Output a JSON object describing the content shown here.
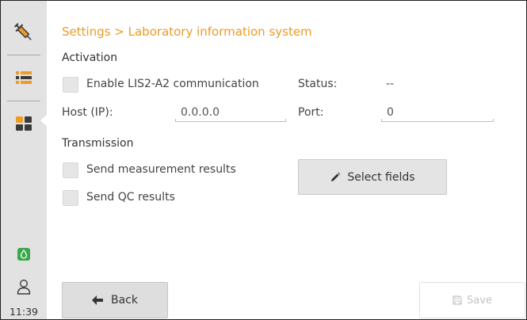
{
  "sidebar": {
    "items": [
      {
        "name": "syringe-icon",
        "active": false
      },
      {
        "name": "list-icon",
        "active": false
      },
      {
        "name": "grid-icon",
        "active": true
      }
    ],
    "status_icon": "drop-icon",
    "user_icon": "user-icon",
    "time": "11:39"
  },
  "colors": {
    "accent": "#ee9a25",
    "sidebar_bg": "#e2e2e2",
    "status_green": "#3aa84a",
    "icon_dark": "#3b3b3b"
  },
  "header": {
    "breadcrumb": "Settings > Laboratory information system"
  },
  "activation": {
    "title": "Activation",
    "enable_label": "Enable LIS2-A2 communication",
    "enable_checked": false,
    "status_label": "Status:",
    "status_value": "--",
    "host_label": "Host (IP):",
    "host_value": "0.0.0.0",
    "port_label": "Port:",
    "port_value": "0"
  },
  "transmission": {
    "title": "Transmission",
    "send_results_label": "Send measurement results",
    "send_results_checked": false,
    "send_qc_label": "Send QC results",
    "send_qc_checked": false,
    "select_fields_label": "Select fields"
  },
  "footer": {
    "back_label": "Back",
    "save_label": "Save"
  }
}
